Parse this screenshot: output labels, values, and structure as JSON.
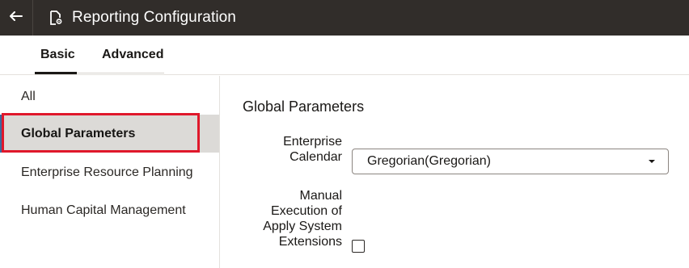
{
  "header": {
    "title": "Reporting Configuration",
    "back_icon": "arrow-left-icon",
    "doc_icon": "document-settings-icon",
    "background": "#312d2a"
  },
  "tabs": [
    {
      "label": "Basic",
      "selected": true
    },
    {
      "label": "Advanced",
      "selected": false
    }
  ],
  "sidebar": {
    "items": [
      {
        "label": "All",
        "selected": false
      },
      {
        "label": "Global Parameters",
        "selected": true
      },
      {
        "label": "Enterprise Resource Planning",
        "selected": false
      },
      {
        "label": "Human Capital Management",
        "selected": false
      }
    ],
    "highlight_color": "#e0182b"
  },
  "main": {
    "section_title": "Global Parameters",
    "fields": {
      "calendar_label_line1": "Enterprise",
      "calendar_label_line2": "Calendar",
      "calendar_value": "Gregorian(Gregorian)",
      "manual_label_line1": "Manual",
      "manual_label_line2": "Execution of",
      "manual_label_line3": "Apply System",
      "manual_label_line4": "Extensions",
      "manual_checked": false
    }
  }
}
